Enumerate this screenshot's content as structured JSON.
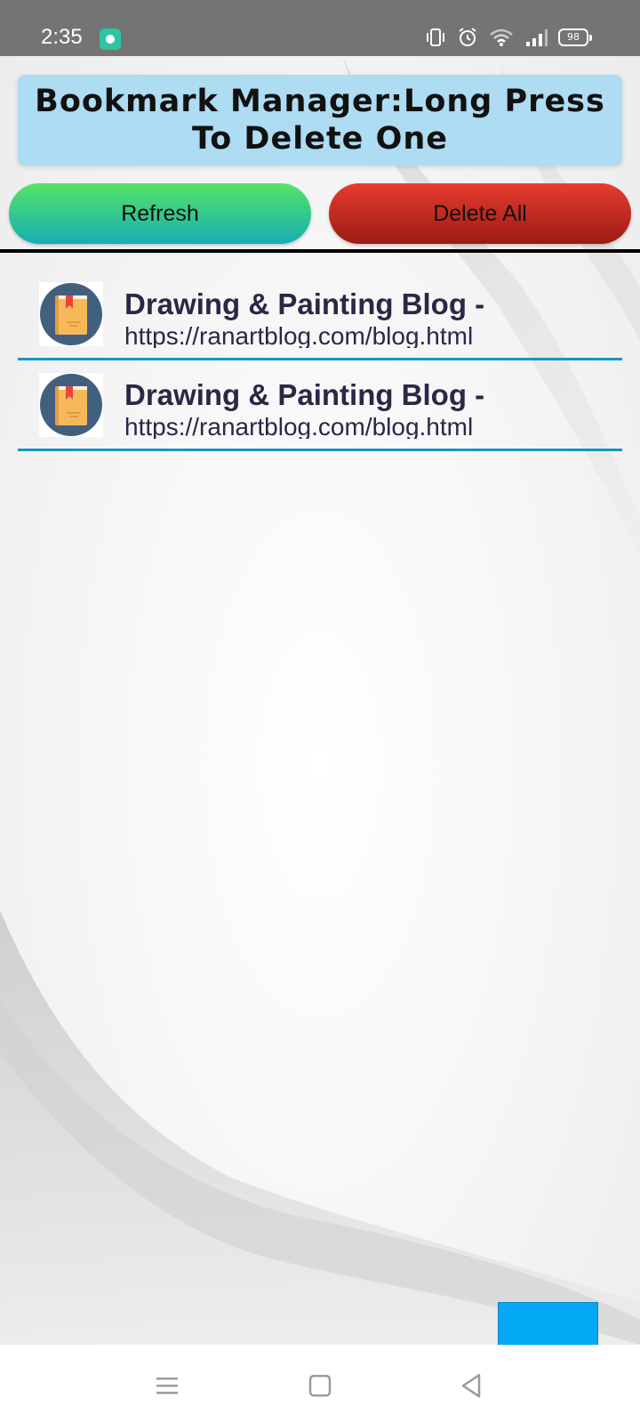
{
  "status_bar": {
    "time": "2:35",
    "battery": "98",
    "icons": [
      "app-notification-icon",
      "vibrate-icon",
      "alarm-icon",
      "wifi-icon",
      "signal-icon",
      "battery-icon"
    ]
  },
  "header": {
    "title": "Bookmark Manager:Long Press To Delete One",
    "background": "#aedcf2"
  },
  "actions": {
    "refresh_label": "Refresh",
    "delete_all_label": "Delete All",
    "refresh_colors": [
      "#55e367",
      "#15aeb3"
    ],
    "delete_colors": [
      "#e83c30",
      "#9c1a14"
    ]
  },
  "bookmarks": [
    {
      "title": "Drawing & Painting Blog -",
      "url": "https://ranartblog.com/blog.html",
      "icon": "bookmark-book-icon"
    },
    {
      "title": "Drawing & Painting Blog -",
      "url": "https://ranartblog.com/blog.html",
      "icon": "bookmark-book-icon"
    }
  ],
  "colors": {
    "accent_divider": "#1597c1",
    "text": "#2e2646",
    "fab": "#03a9f4"
  },
  "nav_bar": {
    "icons": [
      "menu-icon",
      "home-icon",
      "back-icon"
    ]
  }
}
